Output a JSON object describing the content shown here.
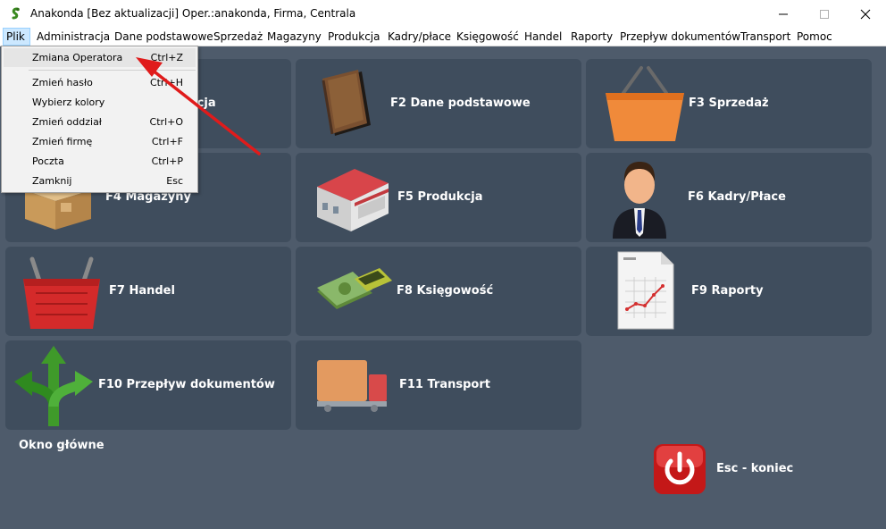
{
  "window": {
    "title": "Anakonda [Bez aktualizacji] Oper.:anakonda, Firma, Centrala"
  },
  "menubar": {
    "items": [
      {
        "label": "Plik"
      },
      {
        "label": "Administracja"
      },
      {
        "label": "Dane podstawowe"
      },
      {
        "label": "Sprzedaż"
      },
      {
        "label": "Magazyny"
      },
      {
        "label": "Produkcja"
      },
      {
        "label": "Kadry/płace"
      },
      {
        "label": "Księgowość"
      },
      {
        "label": "Handel"
      },
      {
        "label": "Raporty"
      },
      {
        "label": "Przepływ dokumentów"
      },
      {
        "label": "Transport"
      },
      {
        "label": "Pomoc"
      }
    ]
  },
  "file_menu": {
    "items": [
      {
        "label": "Zmiana Operatora",
        "shortcut": "Ctrl+Z"
      },
      {
        "label": "Zmień hasło",
        "shortcut": "Ctrl+H"
      },
      {
        "label": "Wybierz kolory",
        "shortcut": ""
      },
      {
        "label": "Zmień oddział",
        "shortcut": "Ctrl+O"
      },
      {
        "label": "Zmień firmę",
        "shortcut": "Ctrl+F"
      },
      {
        "label": "Poczta",
        "shortcut": "Ctrl+P"
      },
      {
        "label": "Zamknij",
        "shortcut": "Esc"
      }
    ]
  },
  "tiles": [
    {
      "label": "F1 Administracja",
      "icon": "gears-icon"
    },
    {
      "label": "F2 Dane podstawowe",
      "icon": "book-icon"
    },
    {
      "label": "F3 Sprzedaż",
      "icon": "basket-icon"
    },
    {
      "label": "F4 Magazyny",
      "icon": "boxes-icon"
    },
    {
      "label": "F5 Produkcja",
      "icon": "factory-icon"
    },
    {
      "label": "F6 Kadry/Płace",
      "icon": "person-icon"
    },
    {
      "label": "F7 Handel",
      "icon": "red-basket-icon"
    },
    {
      "label": "F8 Księgowość",
      "icon": "money-calculator-icon"
    },
    {
      "label": "F9 Raporty",
      "icon": "report-icon"
    },
    {
      "label": "F10 Przepływ dokumentów",
      "icon": "arrows-icon"
    },
    {
      "label": "F11 Transport",
      "icon": "truck-icon"
    }
  ],
  "footer": {
    "caption": "Okno główne",
    "exit_label": "Esc - koniec"
  },
  "colors": {
    "background": "#4e5b6b",
    "tile": "#3f4d5d",
    "menu_highlight": "#cce8ff",
    "annotation_arrow": "#e01b1b"
  }
}
